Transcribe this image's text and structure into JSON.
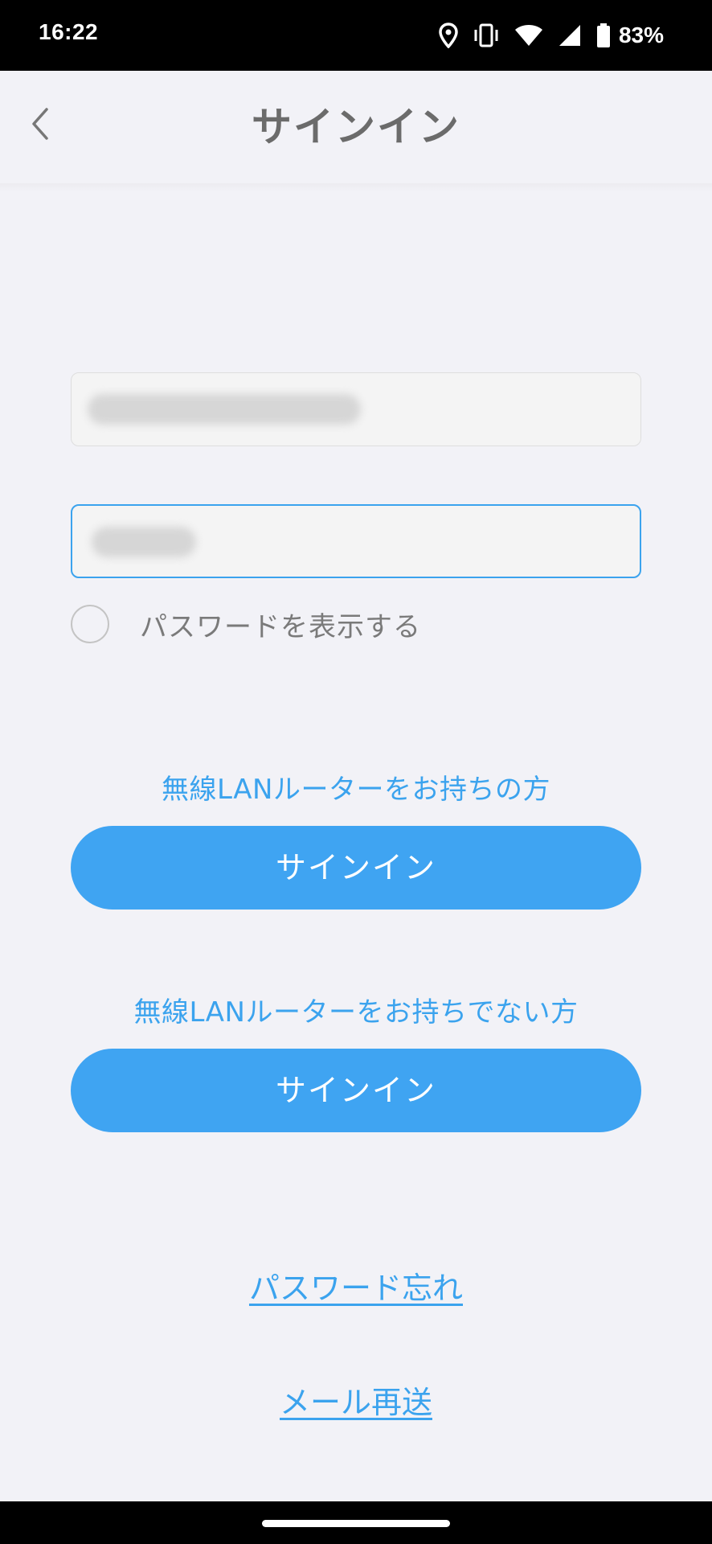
{
  "status_bar": {
    "time": "16:22",
    "battery": "83%",
    "icons": [
      "location-icon",
      "vibrate-icon",
      "wifi-icon",
      "signal-icon",
      "battery-icon"
    ]
  },
  "header": {
    "title": "サインイン",
    "back_icon": "chevron-left-icon"
  },
  "form": {
    "email_value_redacted": true,
    "password_value_redacted": true,
    "show_password_label": "パスワードを表示する",
    "show_password_checked": false
  },
  "sections": [
    {
      "label": "無線LANルーターをお持ちの方",
      "button": "サインイン"
    },
    {
      "label": "無線LANルーターをお持ちでない方",
      "button": "サインイン"
    }
  ],
  "links": {
    "forgot_password": "パスワード忘れ",
    "resend_email": "メール再送"
  },
  "colors": {
    "accent": "#3fa4f2",
    "background": "#f2f2f7",
    "title": "#6b6b6b"
  }
}
